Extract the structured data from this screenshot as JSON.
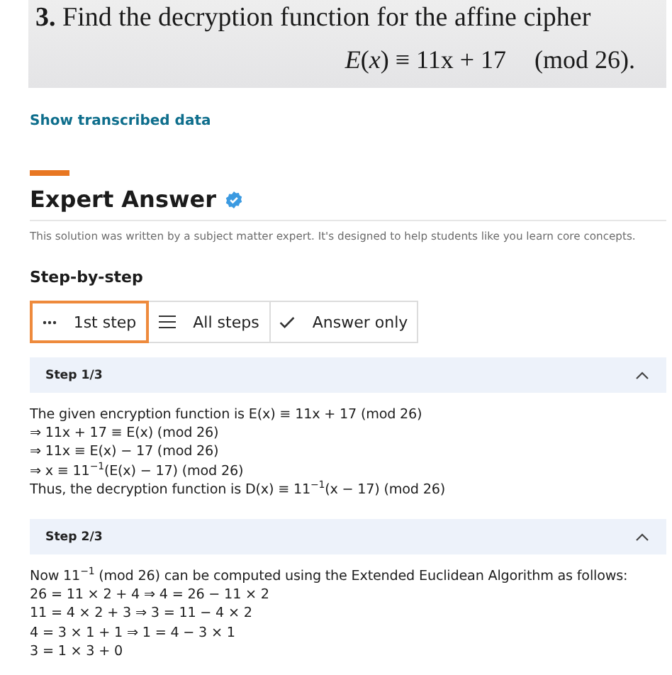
{
  "question": {
    "number": "3.",
    "text": "Find the decryption function for the affine cipher",
    "formula": "E(x) ≡ 11x + 17",
    "modulus": "(mod 26)."
  },
  "transcribed_link": "Show transcribed data",
  "expert_answer": {
    "title": "Expert Answer",
    "note": "This solution was written by a subject matter expert. It's designed to help students like you learn core concepts."
  },
  "mode_heading": "Step-by-step",
  "tabs": [
    {
      "label": "1st step",
      "kind": "dots",
      "selected": true
    },
    {
      "label": "All steps",
      "kind": "list",
      "selected": false
    },
    {
      "label": "Answer only",
      "kind": "check",
      "selected": false
    }
  ],
  "steps": [
    {
      "title": "Step 1/3",
      "expanded": true,
      "lines": [
        "The given encryption function is E(x) ≡ 11x + 17 (mod 26)",
        "⇒ 11x + 17 ≡ E(x) (mod 26)",
        "⇒ 11x ≡ E(x) − 17 (mod 26)",
        "⇒ x ≡ 11$^{−1}$(E(x) − 17) (mod 26)",
        "Thus, the decryption function is D(x) ≡ 11$^{−1}$(x − 17) (mod 26)"
      ]
    },
    {
      "title": "Step 2/3",
      "expanded": true,
      "lines": [
        "Now 11$^{−1}$ (mod 26) can be computed using the Extended Euclidean Algorithm as follows:",
        "26 = 11 × 2 + 4 ⇒ 4 = 26 − 11 × 2",
        "11 = 4 × 2 + 3 ⇒ 3 = 11 − 4 × 2",
        "4 = 3 × 1 + 1 ⇒ 1 = 4 − 3 × 1",
        "3 = 1 × 3 + 0"
      ]
    }
  ]
}
